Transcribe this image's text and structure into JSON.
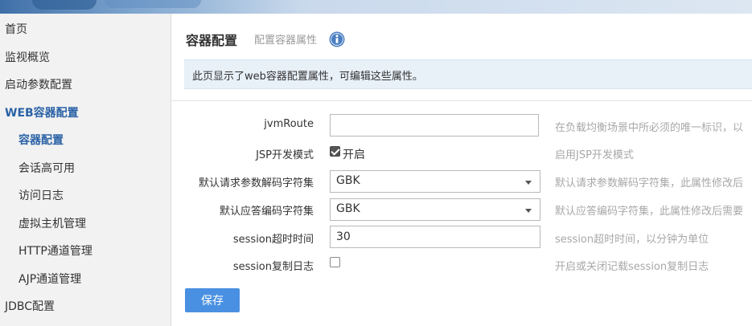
{
  "sidebar": {
    "items": [
      {
        "label": "首页"
      },
      {
        "label": "监视概览"
      },
      {
        "label": "启动参数配置"
      },
      {
        "label": "WEB容器配置"
      },
      {
        "label": "容器配置"
      },
      {
        "label": "会话高可用"
      },
      {
        "label": "访问日志"
      },
      {
        "label": "虚拟主机管理"
      },
      {
        "label": "HTTP通道管理"
      },
      {
        "label": "AJP通道管理"
      },
      {
        "label": "JDBC配置"
      }
    ]
  },
  "header": {
    "title": "容器配置",
    "subtitle": "配置容器属性",
    "info_icon": "info-icon"
  },
  "notice": "此页显示了web容器配置属性，可编辑这些属性。",
  "form": {
    "jvm_route": {
      "label": "jvmRoute",
      "value": "",
      "help": "在负载均衡场景中所必须的唯一标识，以"
    },
    "jsp_dev_mode": {
      "label": "JSP开发模式",
      "checked": true,
      "check_label": "开启",
      "help": "启用JSP开发模式"
    },
    "req_charset": {
      "label": "默认请求参数解码字符集",
      "value": "GBK",
      "help": "默认请求参数解码字符集，此属性修改后"
    },
    "resp_charset": {
      "label": "默认应答编码字符集",
      "value": "GBK",
      "help": "默认应答编码字符集，此属性修改后需要"
    },
    "session_timeout": {
      "label": "session超时时间",
      "value": "30",
      "help": "session超时时间，以分钟为单位"
    },
    "session_log": {
      "label": "session复制日志",
      "checked": false,
      "help": "开启或关闭记载session复制日志"
    }
  },
  "save_label": "保存",
  "colors": {
    "accent": "#4a90e2",
    "active_nav": "#2a62a6",
    "notice_bg": "#e8f0f8"
  }
}
